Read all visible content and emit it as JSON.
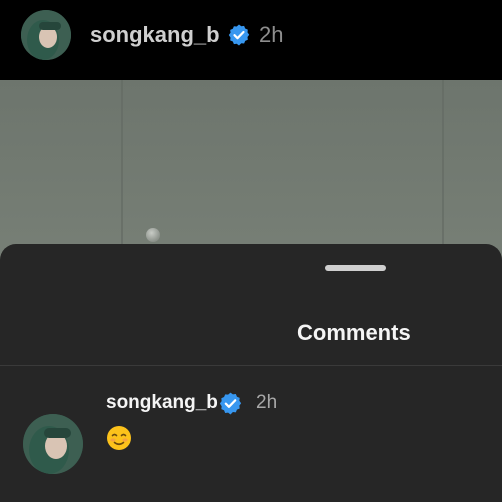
{
  "story_header": {
    "username": "songkang_b",
    "verified_icon": "verified-badge-icon",
    "time": "2h"
  },
  "comments_sheet": {
    "title": "Comments",
    "comments": [
      {
        "username": "songkang_b",
        "verified_icon": "verified-badge-icon",
        "time": "2h",
        "text": "☺️"
      }
    ]
  },
  "colors": {
    "background": "#000000",
    "sheet": "#262626",
    "verified_blue": "#3797f0",
    "text_primary": "#f5f5f5",
    "text_secondary": "#a8a8a8"
  }
}
